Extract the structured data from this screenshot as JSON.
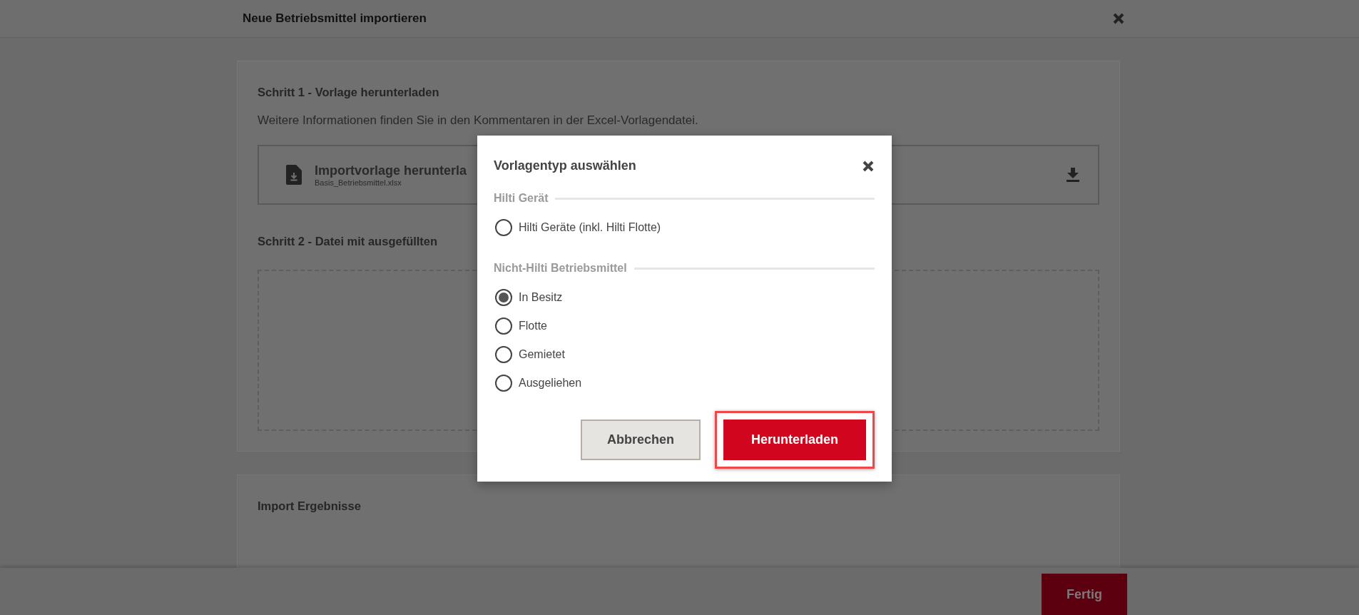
{
  "window": {
    "title": "Neue Betriebsmittel importieren"
  },
  "step1": {
    "heading": "Schritt 1 - Vorlage herunterladen",
    "description": "Weitere Informationen finden Sie in den Kommentaren in der Excel-Vorlagendatei.",
    "file": {
      "title": "Importvorlage herunterla",
      "filename": "Basis_Betriebsmittel.xlsx"
    }
  },
  "step2": {
    "heading": "Schritt 2 - Datei mit ausgefüllten"
  },
  "results": {
    "heading": "Import Ergebnisse"
  },
  "footer": {
    "buttons": [
      {
        "label": "Fertig"
      }
    ]
  },
  "dialog": {
    "title": "Vorlagentyp auswählen",
    "groups": [
      {
        "label": "Hilti Gerät",
        "options": [
          {
            "label": "Hilti Geräte (inkl. Hilti Flotte)",
            "selected": false
          }
        ]
      },
      {
        "label": "Nicht-Hilti Betriebsmittel",
        "options": [
          {
            "label": "In Besitz",
            "selected": true
          },
          {
            "label": "Flotte",
            "selected": false
          },
          {
            "label": "Gemietet",
            "selected": false
          },
          {
            "label": "Ausgeliehen",
            "selected": false
          }
        ]
      }
    ],
    "buttons": [
      {
        "label": "Abbrechen",
        "kind": "secondary",
        "highlighted": false
      },
      {
        "label": "Herunterladen",
        "kind": "primary",
        "highlighted": true
      }
    ]
  }
}
